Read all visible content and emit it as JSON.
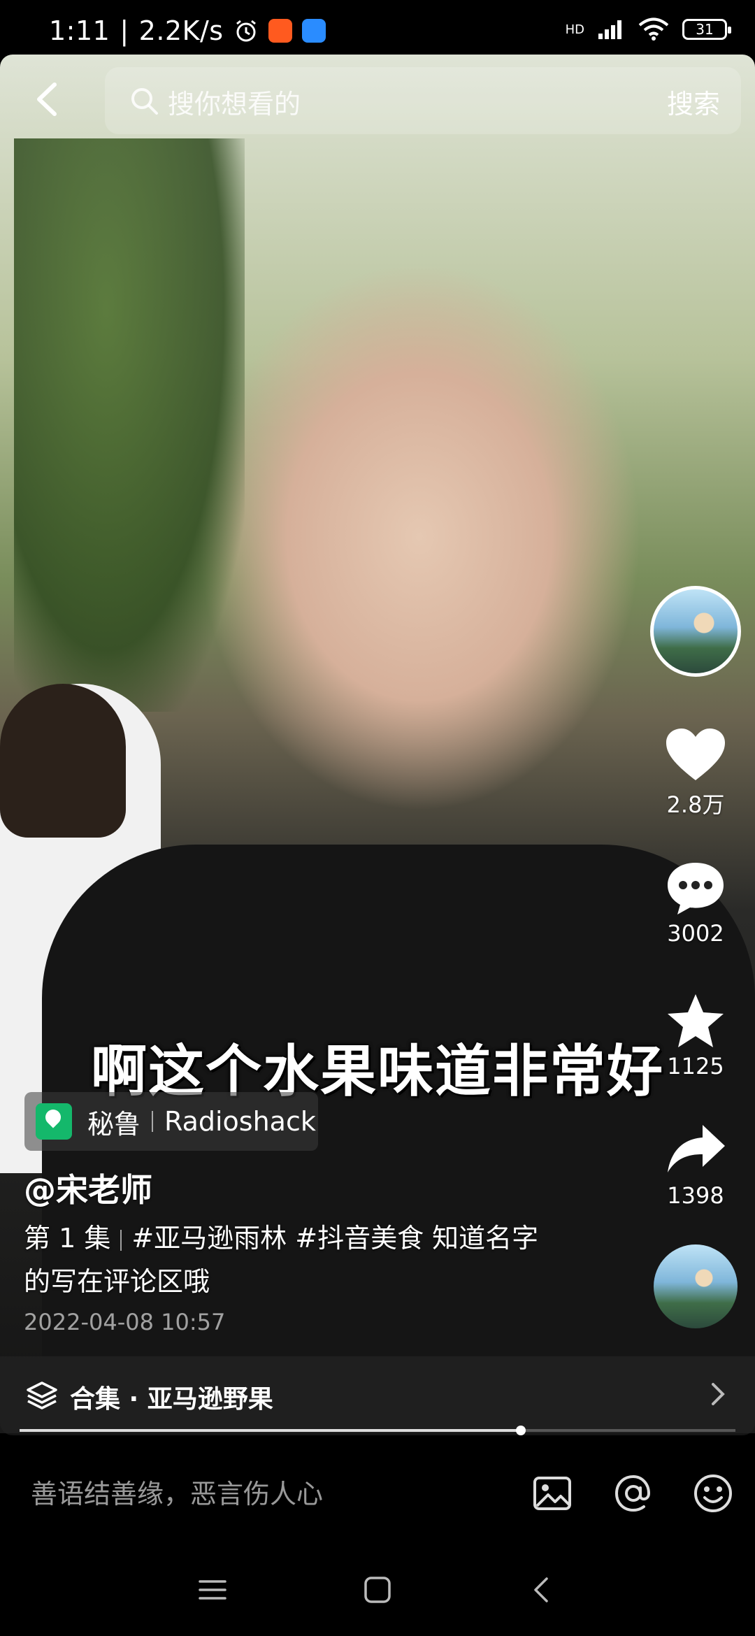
{
  "status_bar": {
    "time": "1:11",
    "speed": "2.2K/s",
    "signal_label": "HD",
    "battery": "31"
  },
  "search": {
    "placeholder": "搜你想看的",
    "button": "搜索"
  },
  "rail": {
    "likes": "2.8万",
    "comments": "3002",
    "favorites": "1125",
    "shares": "1398"
  },
  "video": {
    "subtitle": "啊这个水果味道非常好",
    "location_country": "秘鲁",
    "location_place": "Radioshack",
    "author": "@宋老师",
    "episode": "第 1 集",
    "description_line1": "#亚马逊雨林 #抖音美食  知道名字",
    "description_line2": "的写在评论区哦",
    "date": "2022-04-08 10:57",
    "progress": 0.7
  },
  "collection": {
    "label": "合集 · 亚马逊野果"
  },
  "comment_bar": {
    "placeholder": "善语结善缘，恶言伤人心"
  },
  "colors": {
    "location_pin": "#14b86b",
    "background": "#000000"
  }
}
